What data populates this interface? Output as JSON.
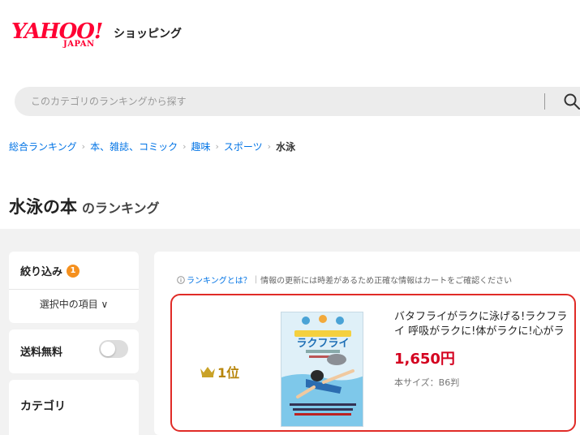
{
  "header": {
    "logo_text": "YAHOO!",
    "logo_sub": "JAPAN",
    "service_name": "ショッピング"
  },
  "search": {
    "placeholder": "このカテゴリのランキングから探す"
  },
  "breadcrumb": {
    "items": [
      "総合ランキング",
      "本、雑誌、コミック",
      "趣味",
      "スポーツ"
    ],
    "current": "水泳",
    "separator": "›"
  },
  "page_title": {
    "main": "水泳の本",
    "sub": "のランキング"
  },
  "sidebar": {
    "filter_label": "絞り込み",
    "filter_count": "1",
    "selected_items_label": "選択中の項目 ∨",
    "free_shipping_label": "送料無料",
    "free_shipping_enabled": false,
    "category_label": "カテゴリ"
  },
  "notice": {
    "link_text": "ランキングとは？",
    "message": "情報の更新には時差があるため正確な情報はカートをご確認ください"
  },
  "ranking": {
    "items": [
      {
        "rank": "1位",
        "title": "バタフライがラクに泳げる!ラクフライ 呼吸がラクに!体がラクに!心がラク…",
        "price": "1,650円",
        "spec": "本サイズ：B6判",
        "cover_title": "ラクフライ"
      }
    ]
  },
  "colors": {
    "accent_red": "#ff0033",
    "link_blue": "#0073e5",
    "price_red": "#d4001f",
    "badge_orange": "#f5901e",
    "highlight_border": "#e02b27",
    "gold": "#b8860b"
  }
}
